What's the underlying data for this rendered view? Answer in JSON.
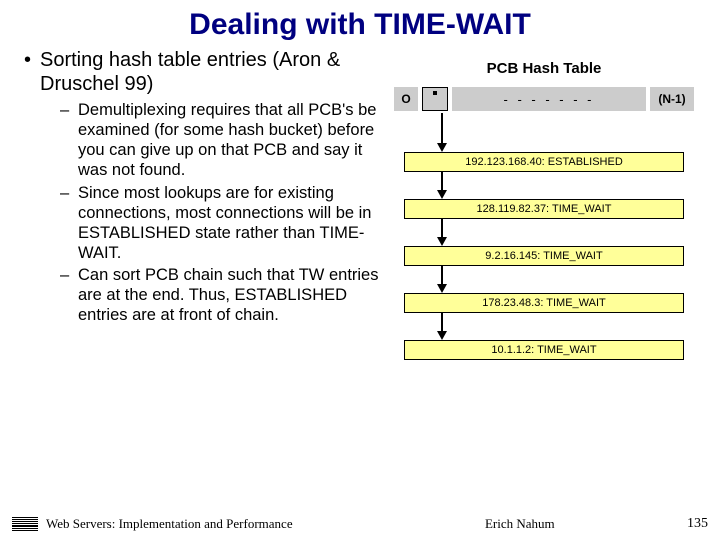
{
  "title": "Dealing with TIME-WAIT",
  "main_bullet": "Sorting hash table entries (Aron & Druschel 99)",
  "sub_bullets": [
    "Demultiplexing requires that all PCB's be examined (for some hash bucket) before you can give up on that PCB and say it was not found.",
    "Since most lookups are for existing connections, most connections will be in ESTABLISHED state rather than TIME-WAIT.",
    "Can sort PCB chain such that TW entries are at the end. Thus, ESTABLISHED entries are at front of chain."
  ],
  "diagram": {
    "title": "PCB Hash Table",
    "left_label": "O",
    "dashes": "- - - - - - -",
    "right_label": "(N-1)",
    "entries": [
      "192.123.168.40: ESTABLISHED",
      "128.119.82.37: TIME_WAIT",
      "9.2.16.145: TIME_WAIT",
      "178.23.48.3: TIME_WAIT",
      "10.1.1.2: TIME_WAIT"
    ]
  },
  "footer": {
    "left": "Web Servers: Implementation and Performance",
    "center": "Erich Nahum",
    "right": "135"
  }
}
